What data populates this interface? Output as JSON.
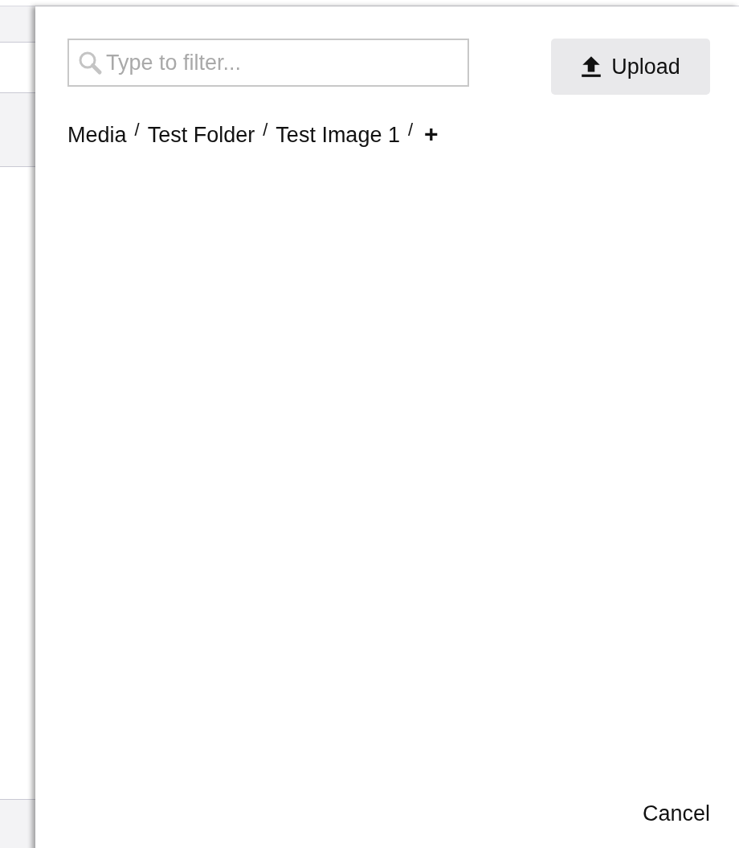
{
  "filter": {
    "placeholder": "Type to filter..."
  },
  "upload_button": {
    "label": "Upload"
  },
  "breadcrumb": [
    {
      "label": "Media",
      "separator": "/"
    },
    {
      "label": "Test Folder",
      "separator": "/"
    },
    {
      "label": "Test Image 1",
      "separator": "/"
    }
  ],
  "add_button": {
    "label": "+"
  },
  "cancel_button": {
    "label": "Cancel"
  }
}
